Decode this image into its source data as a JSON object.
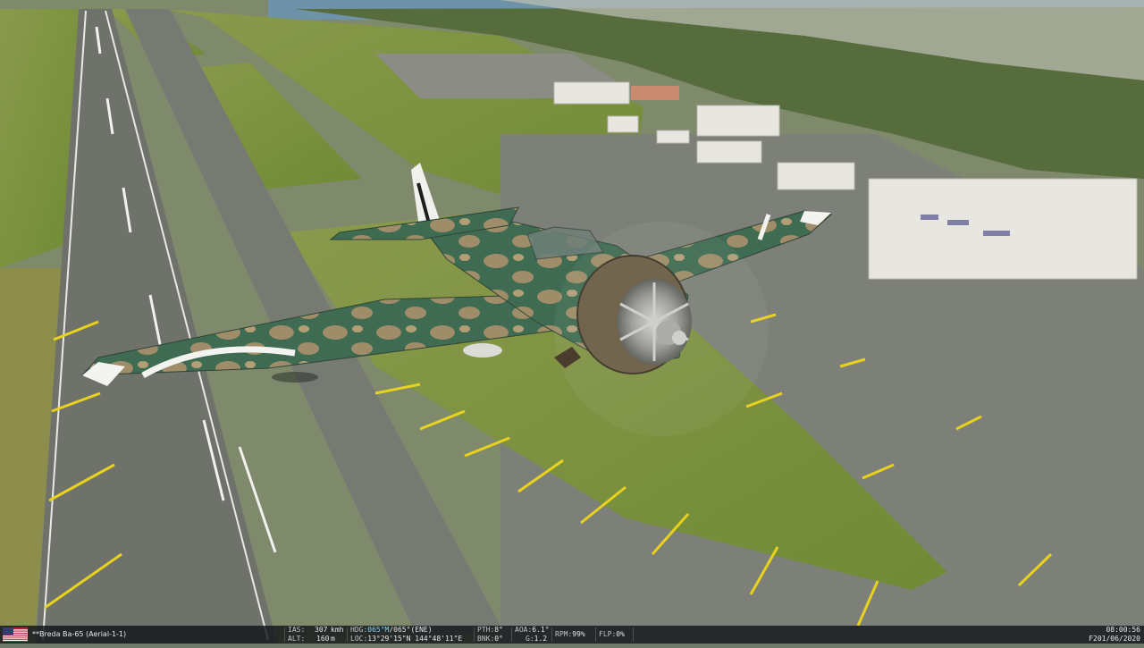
{
  "scene": {
    "description_icon": "aircraft-flyby-over-airfield",
    "aircraft_livery": "green-brown-camouflage",
    "colors": {
      "grass": "#7c8c3f",
      "tarmac": "#7b7d77",
      "water": "#6e93a8",
      "markings": "#e8d21e"
    }
  },
  "hud": {
    "flag_icon": "us-flag-icon",
    "callsign": "**Breda Ba-65 (Aerial-1-1)",
    "ias_label": "IAS:",
    "ias_value": "307",
    "ias_unit": "kmh",
    "alt_label": "ALT:",
    "alt_value": "160",
    "alt_unit": "m",
    "hdg_label": "HDG:",
    "hdg_mag": "065°M",
    "hdg_true": "/065°(ENE)",
    "loc_label": "LOC:",
    "loc_value": "13°29'15\"N 144°48'11\"E",
    "pth_label": "PTH:",
    "pth_value": "8°",
    "bnk_label": "BNK:",
    "bnk_value": "0°",
    "aoa_label": "AOA:",
    "aoa_value": "6.1°",
    "g_label": "G:",
    "g_value": "1.2",
    "rpm_label": "RPM:",
    "rpm_value": "99%",
    "flp_label": "FLP:",
    "flp_value": "0%",
    "time": "08:00:56",
    "date": "F201/06/2020"
  }
}
